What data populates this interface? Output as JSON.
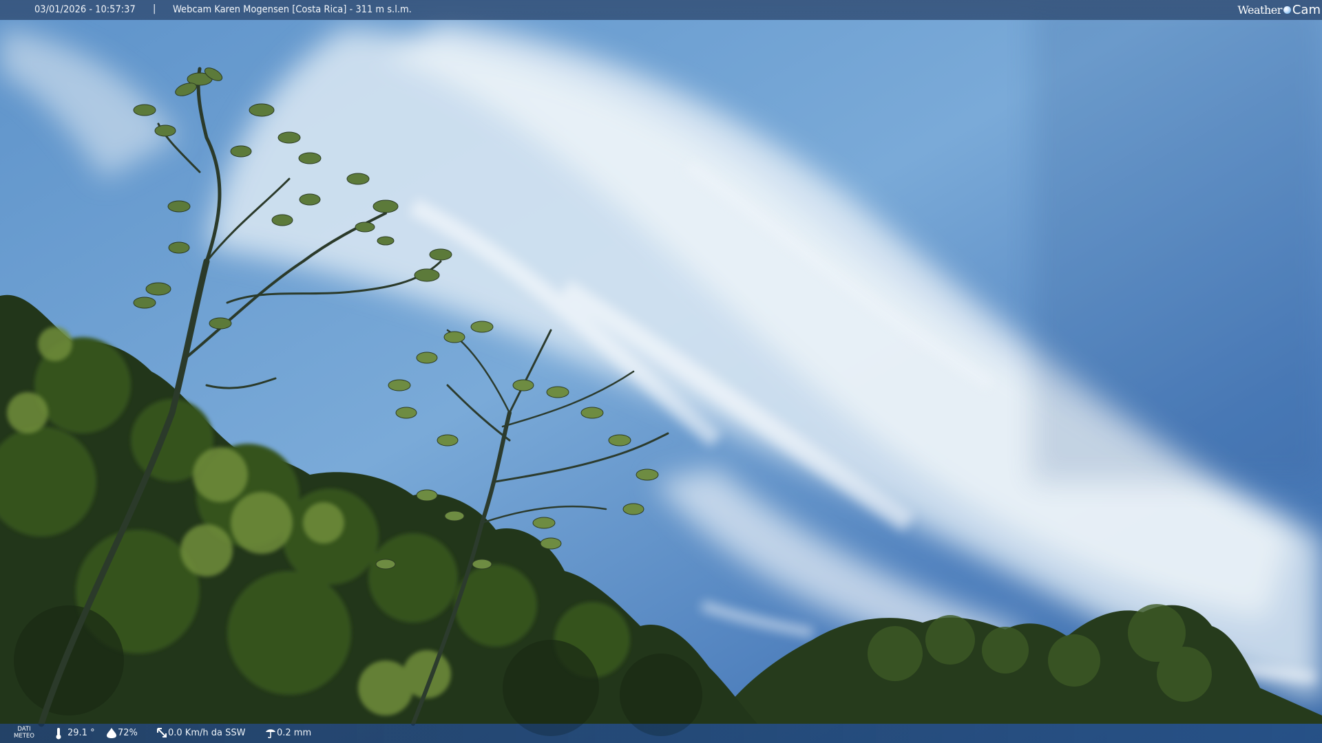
{
  "header": {
    "datetime": "03/01/2026 - 10:57:37",
    "separator": "|",
    "title": "Webcam Karen Mogensen [Costa Rica] - 311 m s.l.m."
  },
  "logo": {
    "word1": "Weather",
    "word2": "Cam"
  },
  "weather": {
    "label_line1": "DATI",
    "label_line2": "METEO",
    "temperature": "29.1 °",
    "humidity": "72%",
    "wind": "0.0 Km/h da SSW",
    "rain": "0.2 mm",
    "icons": [
      "thermometer-icon",
      "humidity-drop-icon",
      "wind-icon",
      "rain-icon"
    ]
  },
  "colors": {
    "sky_top": "#5b90c8",
    "sky_mid": "#8fbbe0",
    "clouds": "#e6eff6",
    "foliage_dark": "#1f3418",
    "foliage_light": "#6c8a3a"
  }
}
